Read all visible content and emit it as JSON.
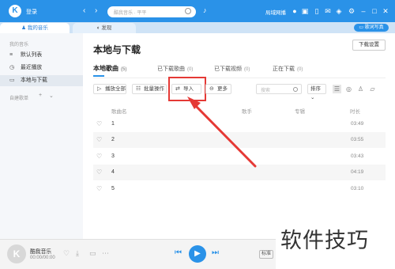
{
  "titlebar": {
    "login_label": "登录",
    "search_placeholder": "酷我音乐 · 平平",
    "header_link": "局域网播"
  },
  "tabs": {
    "my_music": "我的音乐",
    "discover": "发现",
    "right_button": "歌词写真"
  },
  "sidebar": {
    "section_my_music": "我的音乐",
    "items": [
      {
        "label": "默认列表",
        "icon": "list-icon"
      },
      {
        "label": "最近播放",
        "icon": "clock-icon"
      },
      {
        "label": "本地与下载",
        "icon": "monitor-icon"
      }
    ],
    "section_created": "自建歌单",
    "active_index": 2
  },
  "main": {
    "title": "本地与下载",
    "settings_button": "下载设置",
    "subtabs": [
      {
        "label": "本地歌曲",
        "count": "(5)"
      },
      {
        "label": "已下载歌曲",
        "count": "(0)"
      },
      {
        "label": "已下载视频",
        "count": "(0)"
      },
      {
        "label": "正在下载",
        "count": "(0)"
      }
    ],
    "toolbar": {
      "play_all": "播放全部",
      "batch": "批量操作",
      "import": "导入",
      "more": "更多",
      "search_placeholder": "搜索",
      "sort": "排序"
    },
    "columns": {
      "song": "歌曲名",
      "artist": "歌手",
      "album": "专辑",
      "duration": "时长"
    },
    "rows": [
      {
        "num": "1",
        "duration": "03:49"
      },
      {
        "num": "2",
        "duration": "03:55"
      },
      {
        "num": "3",
        "duration": "03:43"
      },
      {
        "num": "4",
        "duration": "04:19"
      },
      {
        "num": "5",
        "duration": "03:10"
      }
    ]
  },
  "player": {
    "title": "酷我音乐",
    "time": "00:00/00:00",
    "quality": "标准"
  },
  "watermark": "软件技巧",
  "colors": {
    "accent": "#2a92e8",
    "highlight": "#e53935"
  }
}
